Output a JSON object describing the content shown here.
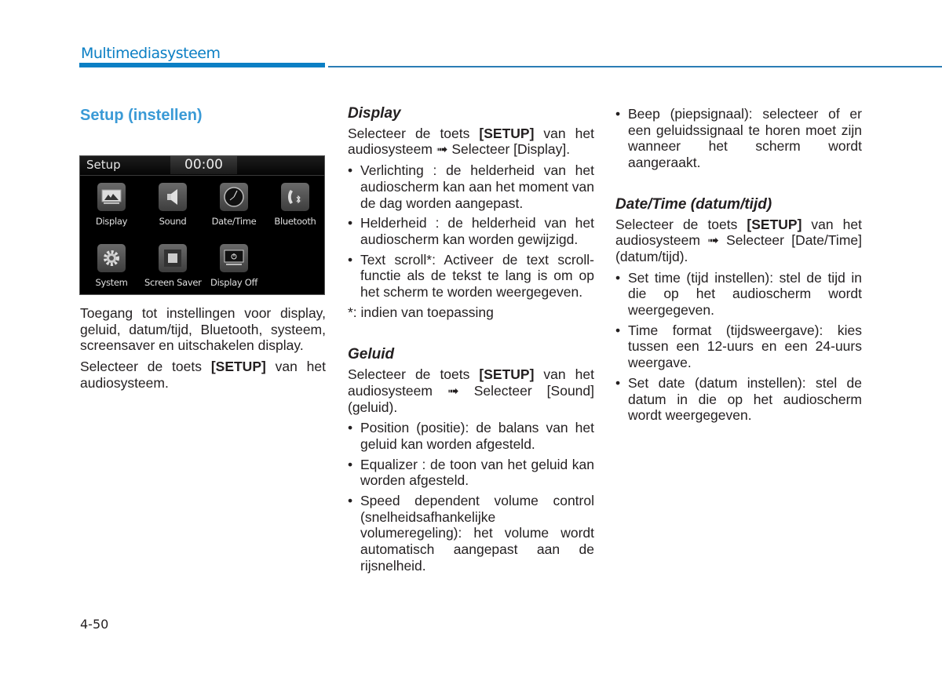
{
  "header": {
    "title": "Multimediasysteem",
    "accent_color": "#0b7fc4"
  },
  "section_title": "Setup (instellen)",
  "setup_screen": {
    "title": "Setup",
    "clock": "00:00",
    "tiles": [
      {
        "label": "Display",
        "icon": "display-icon"
      },
      {
        "label": "Sound",
        "icon": "speaker-icon"
      },
      {
        "label": "Date/Time",
        "icon": "clock-icon"
      },
      {
        "label": "Bluetooth",
        "icon": "bluetooth-phone-icon"
      },
      {
        "label": "System",
        "icon": "gear-icon"
      },
      {
        "label": "Screen Saver",
        "icon": "screen-saver-icon"
      },
      {
        "label": "Display Off",
        "icon": "display-off-icon"
      }
    ]
  },
  "column1": {
    "intro": "Toegang tot instellingen voor display, geluid, datum/tijd, Bluetooth, systeem, screensaver en uitschakelen display.",
    "select_prefix": "Selecteer de toets ",
    "select_key": "[SETUP]",
    "select_suffix": " van het audiosysteem."
  },
  "display_section": {
    "heading": "Display",
    "instr_prefix": "Selecteer de toets ",
    "instr_key": "[SETUP]",
    "instr_suffix": " van het audiosysteem ",
    "arrow": "➟",
    "instr_end": " Selecteer [Display].",
    "bullets": [
      "Verlichting : de helderheid van het audioscherm kan aan het moment van de dag worden aangepast.",
      "Helderheid : de helderheid van het audioscherm kan worden gewijzigd.",
      "Text scroll*: Activeer de text scroll-functie als de tekst te lang is om op het scherm te worden weergegeven."
    ],
    "footnote": "*: indien van toepassing"
  },
  "sound_section": {
    "heading": "Geluid",
    "instr_prefix": "Selecteer de toets ",
    "instr_key": "[SETUP]",
    "instr_suffix": " van het audiosysteem ",
    "arrow": "➟",
    "instr_end": " Selecteer [Sound] (geluid).",
    "bullets": [
      "Position (positie): de balans van het geluid kan worden afgesteld.",
      "Equalizer : de toon van het geluid kan worden afgesteld.",
      "Speed dependent volume control (snelheidsafhankelijke volumeregeling): het volume wordt automatisch aangepast aan de rijsnelheid.",
      "Beep (piepsignaal): selecteer of er een geluidssignaal te horen moet zijn wanneer het scherm wordt aangeraakt."
    ]
  },
  "datetime_section": {
    "heading": "Date/Time (datum/tijd)",
    "instr_prefix": "Selecteer de toets ",
    "instr_key": "[SETUP]",
    "instr_suffix": " van het audiosysteem ",
    "arrow": "➟",
    "instr_end": " Selecteer [Date/Time] (datum/tijd).",
    "bullets": [
      "Set time (tijd instellen): stel de tijd in die op het audioscherm wordt weergegeven.",
      "Time format (tijdsweergave): kies tussen een 12-uurs en een 24-uurs weergave.",
      "Set date (datum instellen): stel de datum in die op het audioscherm wordt weergegeven."
    ]
  },
  "bullet_char": "•",
  "page_number": "4-50"
}
